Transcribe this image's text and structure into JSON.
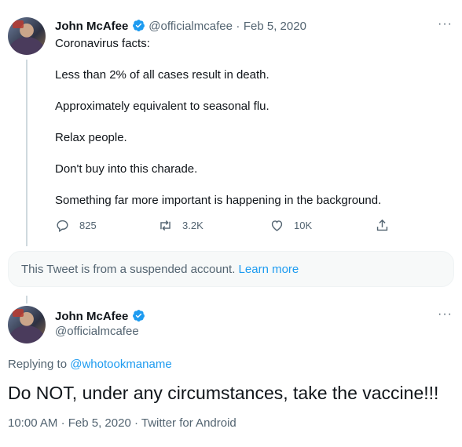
{
  "tweet1": {
    "display_name": "John McAfee",
    "handle": "@officialmcafee",
    "separator": "·",
    "date": "Feb 5, 2020",
    "more_icon": "more-horizontal-icon",
    "lines": [
      "Coronavirus facts:",
      "Less than 2% of all cases result in death.",
      "Approximately equivalent to seasonal flu.",
      "Relax people.",
      "Don't buy into this charade.",
      "Something far more important is happening in the background."
    ],
    "actions": {
      "reply_count": "825",
      "retweet_count": "3.2K",
      "like_count": "10K"
    }
  },
  "notice": {
    "text": "This Tweet is from a suspended account.",
    "link": "Learn more"
  },
  "tweet2": {
    "display_name": "John McAfee",
    "handle": "@officialmcafee",
    "replying_prefix": "Replying to",
    "replying_handle": "@whotookmaname",
    "text": "Do NOT, under any circumstances, take the vaccine!!!",
    "time": "10:00 AM",
    "date": "Feb 5, 2020",
    "client": "Twitter for Android",
    "separator": "·"
  },
  "colors": {
    "accent": "#1d9bf0",
    "text": "#0f1419",
    "muted": "#536471",
    "notice_bg": "#f7f9f9"
  }
}
